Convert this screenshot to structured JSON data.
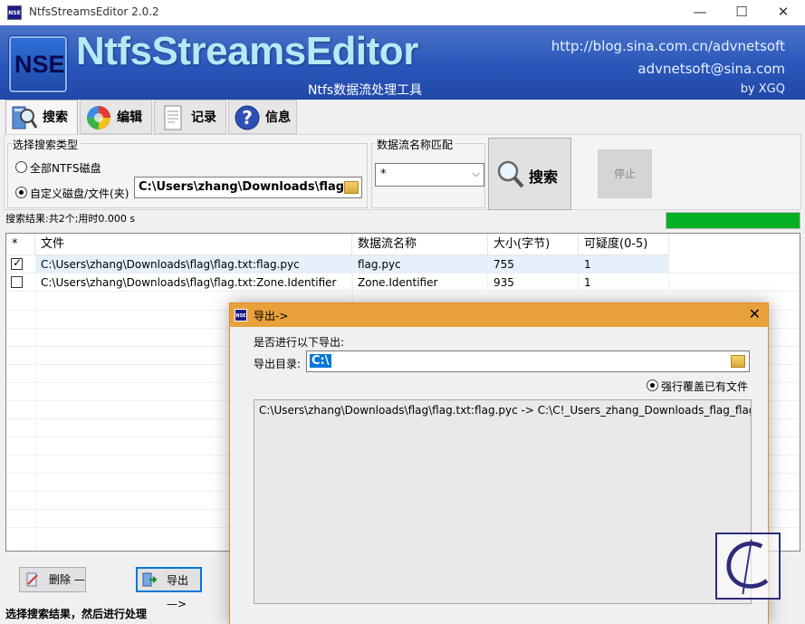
{
  "window": {
    "title": "NtfsStreamsEditor 2.0.2",
    "app_icon_text": "NSE",
    "minimize_label": "—",
    "maximize_label": "☐",
    "close_label": "✕"
  },
  "banner": {
    "logo_text": "NSE",
    "brand": "NtfsStreamsEditor",
    "subtitle": "Ntfs数据流处理工具",
    "blog": "http://blog.sina.com.cn/advnetsoft",
    "email": "advnetsoft@sina.com",
    "byline": "by XGQ"
  },
  "tabs": [
    {
      "label": "搜索",
      "icon": "magnifier-icon",
      "active": true
    },
    {
      "label": "编辑",
      "icon": "globe-icon",
      "active": false
    },
    {
      "label": "记录",
      "icon": "document-icon",
      "active": false
    },
    {
      "label": "信息",
      "icon": "help-icon",
      "active": false
    }
  ],
  "search": {
    "type_group_label": "选择搜索类型",
    "radio_all": "全部NTFS磁盘",
    "radio_custom": "自定义磁盘/文件(夹)",
    "selected_radio": "custom",
    "path_value": "C:\\Users\\zhang\\Downloads\\flag",
    "match_group_label": "数据流名称匹配",
    "match_value": "*",
    "search_button": "搜索",
    "stop_button": "停止"
  },
  "status": {
    "result_text": "搜索结果:共2个;用时0.000 s",
    "progress": 1.0,
    "progress_color": "#06b025"
  },
  "table": {
    "columns": [
      "*",
      "文件",
      "数据流名称",
      "大小(字节)",
      "可疑度(0-5)"
    ],
    "rows": [
      {
        "checked": true,
        "file": "C:\\Users\\zhang\\Downloads\\flag\\flag.txt:flag.pyc",
        "stream": "flag.pyc",
        "size": "755",
        "suspicion": "1",
        "selected": true
      },
      {
        "checked": false,
        "file": "C:\\Users\\zhang\\Downloads\\flag\\flag.txt:Zone.Identifier",
        "stream": "Zone.Identifier",
        "size": "935",
        "suspicion": "1",
        "selected": false
      }
    ]
  },
  "actions": {
    "delete_button": "删除 —",
    "export_button": "导出 —>",
    "hint": "选择搜索结果，然后进行处理"
  },
  "export_dialog": {
    "title": "导出->",
    "icon_text": "NSE",
    "close_label": "✕",
    "prompt": "是否进行以下导出:",
    "dir_label": "导出目录:",
    "dir_value": "C:\\",
    "overwrite_label": "强行覆盖已有文件",
    "overwrite_checked": true,
    "output_line": "C:\\Users\\zhang\\Downloads\\flag\\flag.txt:flag.pyc  ->  C:\\C!_Users_zhang_Downloads_flag_flag."
  },
  "colors": {
    "banner": "#2a56ba",
    "dialog_title": "#e8a13a",
    "selection": "#0078d7",
    "row_highlight": "#e5f0fb"
  }
}
